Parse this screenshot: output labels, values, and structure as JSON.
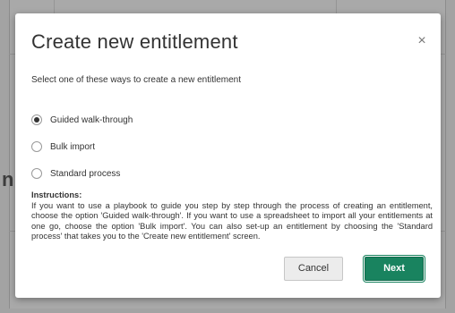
{
  "background": {
    "partial_text": "n"
  },
  "dialog": {
    "title": "Create new entitlement",
    "close_glyph": "×",
    "subtitle": "Select one of these ways to create a new entitlement",
    "options": [
      {
        "label": "Guided walk-through",
        "checked": true
      },
      {
        "label": "Bulk import",
        "checked": false
      },
      {
        "label": "Standard process",
        "checked": false
      }
    ],
    "instructions_title": "Instructions:",
    "instructions_body": "If you want to use a playbook to guide you step by step through the process of creating an entitlement, choose the option 'Guided walk-through'. If you want to use a spreadsheet to import all your entitlements at one go, choose the option 'Bulk import'. You can also set-up an entitlement by choosing the 'Standard process' that takes you to the 'Create new entitlement' screen.",
    "cancel_label": "Cancel",
    "next_label": "Next"
  },
  "colors": {
    "primary_button": "#19835f",
    "overlay": "#a3a3a3"
  },
  "icons": {
    "close": "close-icon"
  }
}
